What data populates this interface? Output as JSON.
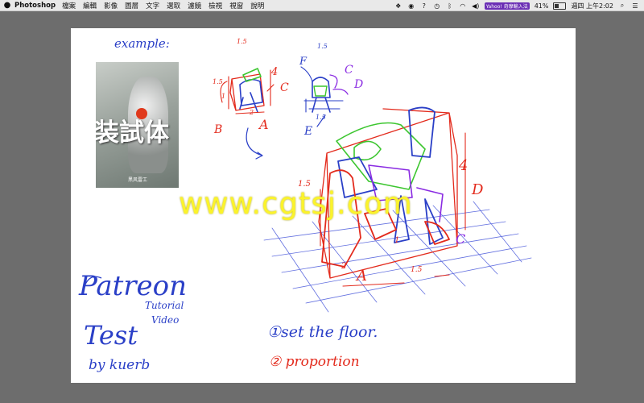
{
  "menubar": {
    "app_name": "Photoshop",
    "menus": [
      "檔案",
      "編輯",
      "影像",
      "圖層",
      "文字",
      "選取",
      "濾鏡",
      "檢視",
      "視窗",
      "說明"
    ],
    "input_method": "Yahoo! 奇摩輸入法",
    "battery_level_percent": 41,
    "battery_label": "41%",
    "clock": "週四 上午2:02"
  },
  "canvas": {
    "photo": {
      "title": "装試体",
      "caption": "黑风雷工"
    },
    "handwriting": {
      "example": "example:",
      "patreon": "Patreon",
      "tutorial": "Tutorial",
      "video": "Video",
      "test": "Test",
      "byline": "by kuerb",
      "step1": "①set the floor.",
      "step2": "② proportion",
      "labels": {
        "sm_15_top": "1.5",
        "sm_15_side": "1.5",
        "sm_1_left": "1",
        "sm_4": "4",
        "sm_2": "2",
        "sm_C": "C",
        "sm_A": "A",
        "sm_B": "B",
        "sm2_15_top": "1.5",
        "sm2_F": "F",
        "sm2_C": "C",
        "sm2_D": "D",
        "sm2_E": "E",
        "sm2_15_bottom": "1.5",
        "big_4": "4",
        "big_D": "D",
        "big_15_left": "1.5",
        "big_2": "2",
        "big_A": "A",
        "big_15_bottom": "1.5",
        "big_C": "C",
        "big_1_mid": "1"
      }
    },
    "watermark": "www.cgtsj.com"
  },
  "colors": {
    "menubar_bg": "#e9e9e9",
    "desktop_bg": "#6d6d6d",
    "canvas_bg": "#ffffff",
    "ink_blue": "#2a3fc7",
    "ink_red": "#e32a1c",
    "ink_green": "#3cc62f",
    "ink_purple": "#8a2be2",
    "watermark": "#fbf32b"
  },
  "icons": [
    "apple-icon",
    "dropbox-icon",
    "record-icon",
    "help-icon",
    "history-icon",
    "bluetooth-icon",
    "wifi-icon",
    "volume-icon",
    "battery-icon",
    "spotlight-icon",
    "list-icon"
  ]
}
